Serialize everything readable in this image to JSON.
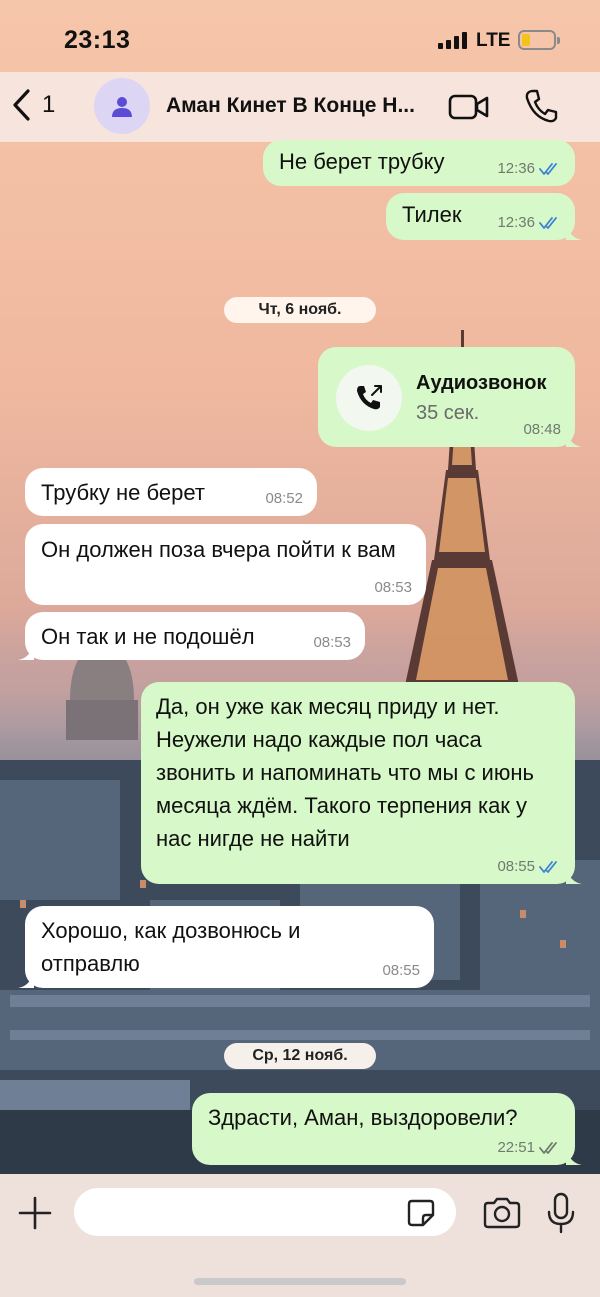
{
  "status_bar": {
    "time": "23:13",
    "network": "LTE"
  },
  "header": {
    "back_count": "1",
    "chat_title": "Аман Кинет В Конце Н..."
  },
  "icons": {
    "back": "chevron-left-icon",
    "avatar": "person-icon",
    "video": "video-camera-icon",
    "phone": "phone-icon",
    "call": "outgoing-call-icon",
    "read": "double-check-icon",
    "plus": "plus-icon",
    "sticker": "sticker-icon",
    "camera": "camera-icon",
    "mic": "microphone-icon"
  },
  "colors": {
    "outgoing": "#d7f8c8",
    "incoming": "#ffffff",
    "read_tick": "#3b82d6",
    "accent": "#5b4bd6"
  },
  "messages": [
    {
      "direction": "out",
      "text": "Не берет трубку",
      "time": "12:36",
      "status": "read"
    },
    {
      "direction": "out",
      "text": "Тилек",
      "time": "12:36",
      "status": "read"
    },
    {
      "type": "date",
      "label": "Чт, 6 нояб."
    },
    {
      "direction": "out",
      "type": "call",
      "title": "Аудиозвонок",
      "duration": "35 сек.",
      "time": "08:48"
    },
    {
      "direction": "in",
      "text": "Трубку  не берет",
      "time": "08:52"
    },
    {
      "direction": "in",
      "text": "Он должен поза вчера пойти  к вам",
      "time": "08:53"
    },
    {
      "direction": "in",
      "text": "Он так и не подошёл",
      "time": "08:53"
    },
    {
      "direction": "out",
      "text": "Да, он уже как месяц приду и нет. Неужели надо каждые пол часа звонить и напоминать что мы с июнь месяца ждём. Такого терпения как у нас нигде не найти",
      "time": "08:55",
      "status": "read"
    },
    {
      "direction": "in",
      "text": "Хорошо,  как дозвонюсь и отправлю",
      "time": "08:55"
    },
    {
      "type": "date",
      "label": "Ср, 12 нояб."
    },
    {
      "direction": "out",
      "text": "Здрасти, Аман, выздоровели?",
      "time": "22:51",
      "status": "delivered"
    }
  ],
  "composer": {
    "placeholder": ""
  }
}
